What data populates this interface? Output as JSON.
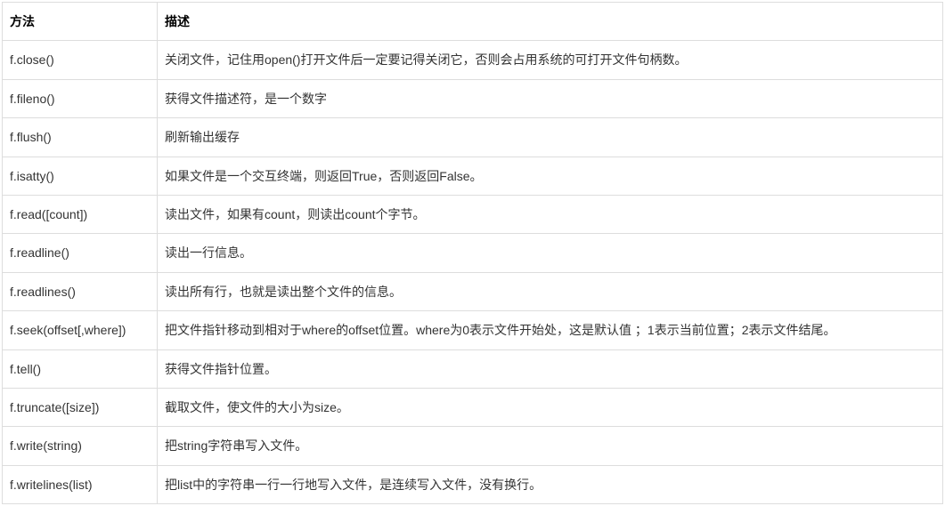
{
  "table": {
    "headers": {
      "method": "方法",
      "description": "描述"
    },
    "rows": [
      {
        "method": "f.close()",
        "description": "关闭文件，记住用open()打开文件后一定要记得关闭它，否则会占用系统的可打开文件句柄数。"
      },
      {
        "method": "f.fileno()",
        "description": "获得文件描述符，是一个数字"
      },
      {
        "method": "f.flush()",
        "description": "刷新输出缓存"
      },
      {
        "method": "f.isatty()",
        "description": "如果文件是一个交互终端，则返回True，否则返回False。"
      },
      {
        "method": "f.read([count])",
        "description": "读出文件，如果有count，则读出count个字节。"
      },
      {
        "method": "f.readline()",
        "description": "读出一行信息。"
      },
      {
        "method": "f.readlines()",
        "description": "读出所有行，也就是读出整个文件的信息。"
      },
      {
        "method": "f.seek(offset[,where])",
        "description": "把文件指针移动到相对于where的offset位置。where为0表示文件开始处，这是默认值 ；1表示当前位置；2表示文件结尾。"
      },
      {
        "method": "f.tell()",
        "description": "获得文件指针位置。"
      },
      {
        "method": "f.truncate([size])",
        "description": "截取文件，使文件的大小为size。"
      },
      {
        "method": "f.write(string)",
        "description": "把string字符串写入文件。"
      },
      {
        "method": "f.writelines(list)",
        "description": "把list中的字符串一行一行地写入文件，是连续写入文件，没有换行。"
      }
    ]
  }
}
